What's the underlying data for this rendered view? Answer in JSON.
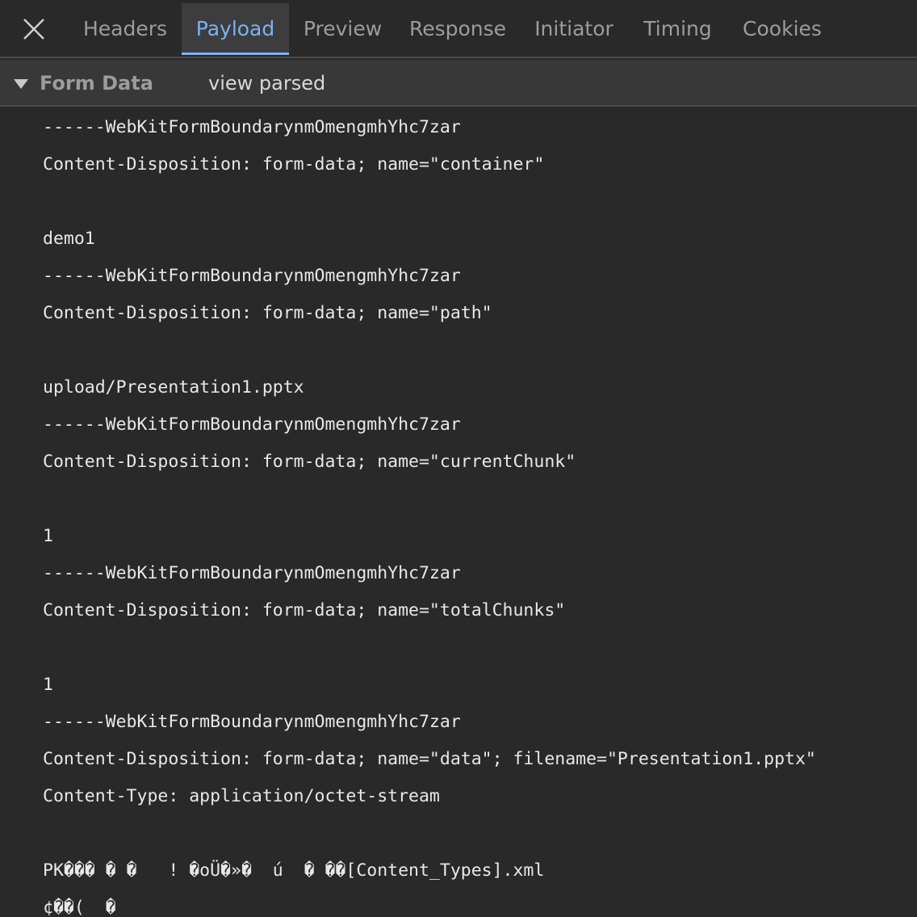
{
  "tabs": [
    {
      "label": "Headers",
      "active": false
    },
    {
      "label": "Payload",
      "active": true
    },
    {
      "label": "Preview",
      "active": false
    },
    {
      "label": "Response",
      "active": false
    },
    {
      "label": "Initiator",
      "active": false
    },
    {
      "label": "Timing",
      "active": false
    },
    {
      "label": "Cookies",
      "active": false
    }
  ],
  "section": {
    "title": "Form Data",
    "toggle_label": "view parsed"
  },
  "payload_lines": [
    "------WebKitFormBoundarynmOmengmhYhc7zar",
    "Content-Disposition: form-data; name=\"container\"",
    "",
    "demo1",
    "------WebKitFormBoundarynmOmengmhYhc7zar",
    "Content-Disposition: form-data; name=\"path\"",
    "",
    "upload/Presentation1.pptx",
    "------WebKitFormBoundarynmOmengmhYhc7zar",
    "Content-Disposition: form-data; name=\"currentChunk\"",
    "",
    "1",
    "------WebKitFormBoundarynmOmengmhYhc7zar",
    "Content-Disposition: form-data; name=\"totalChunks\"",
    "",
    "1",
    "------WebKitFormBoundarynmOmengmhYhc7zar",
    "Content-Disposition: form-data; name=\"data\"; filename=\"Presentation1.pptx\"",
    "Content-Type: application/octet-stream",
    "",
    "PK��� � �   ! �oÜ�»�  ú  � ��[Content_Types].xml",
    "¢��(  �"
  ],
  "colors": {
    "background": "#292929",
    "header_background": "#383838",
    "active_tab_background": "#3d3d3d",
    "accent": "#7cb1f5",
    "inactive_tab_text": "#9c9c9c",
    "text": "#e8e8e8"
  },
  "icons": {
    "close": "close-icon",
    "disclosure": "triangle-down-icon"
  }
}
